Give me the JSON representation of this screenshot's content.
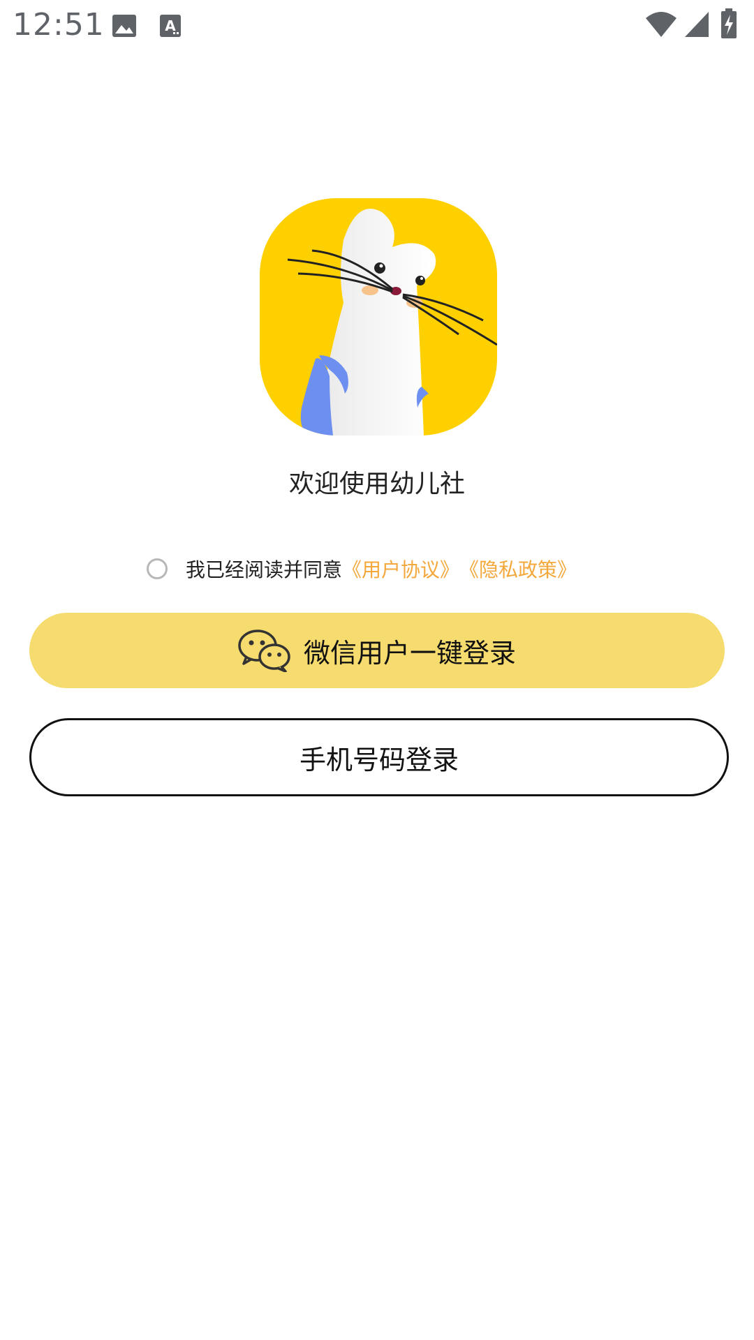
{
  "status_bar": {
    "time": "12:51",
    "icons": [
      "image-icon",
      "text-a-icon",
      "wifi-icon",
      "signal-icon",
      "battery-charging-icon"
    ]
  },
  "app": {
    "logo": "mouse-logo",
    "welcome_text": "欢迎使用幼儿社"
  },
  "agreement": {
    "checked": false,
    "text": "我已经阅读并同意",
    "user_agreement": "《用户协议》",
    "privacy_policy": "《隐私政策》",
    "link_color": "#f4a73b"
  },
  "buttons": {
    "wechat_label": "微信用户一键登录",
    "wechat_icon": "wechat-icon",
    "wechat_color": "#f6db6e",
    "phone_label": "手机号码登录"
  }
}
